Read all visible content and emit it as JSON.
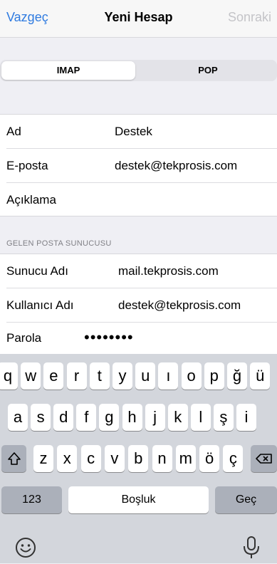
{
  "nav": {
    "cancel": "Vazgeç",
    "title": "Yeni Hesap",
    "next": "Sonraki"
  },
  "segment": {
    "options": [
      "IMAP",
      "POP"
    ],
    "selected": "IMAP"
  },
  "account": {
    "name": {
      "label": "Ad",
      "value": "Destek"
    },
    "email": {
      "label": "E-posta",
      "value": "destek@tekprosis.com"
    },
    "description": {
      "label": "Açıklama",
      "value": ""
    }
  },
  "incoming": {
    "header": "GELEN POSTA SUNUCUSU",
    "host": {
      "label": "Sunucu Adı",
      "value": "mail.tekprosis.com"
    },
    "user": {
      "label": "Kullanıcı Adı",
      "value": "destek@tekprosis.com"
    },
    "password": {
      "label": "Parola",
      "value": "••••••••"
    }
  },
  "keyboard": {
    "row1": [
      "q",
      "w",
      "e",
      "r",
      "t",
      "y",
      "u",
      "ı",
      "o",
      "p",
      "ğ",
      "ü"
    ],
    "row2": [
      "a",
      "s",
      "d",
      "f",
      "g",
      "h",
      "j",
      "k",
      "l",
      "ş",
      "i"
    ],
    "row3": [
      "z",
      "x",
      "c",
      "v",
      "b",
      "n",
      "m",
      "ö",
      "ç"
    ],
    "numbers_label": "123",
    "space_label": "Boşluk",
    "return_label": "Geç",
    "icons": {
      "shift": "shift-icon",
      "delete": "delete-icon",
      "emoji": "emoji-icon",
      "mic": "microphone-icon"
    }
  }
}
